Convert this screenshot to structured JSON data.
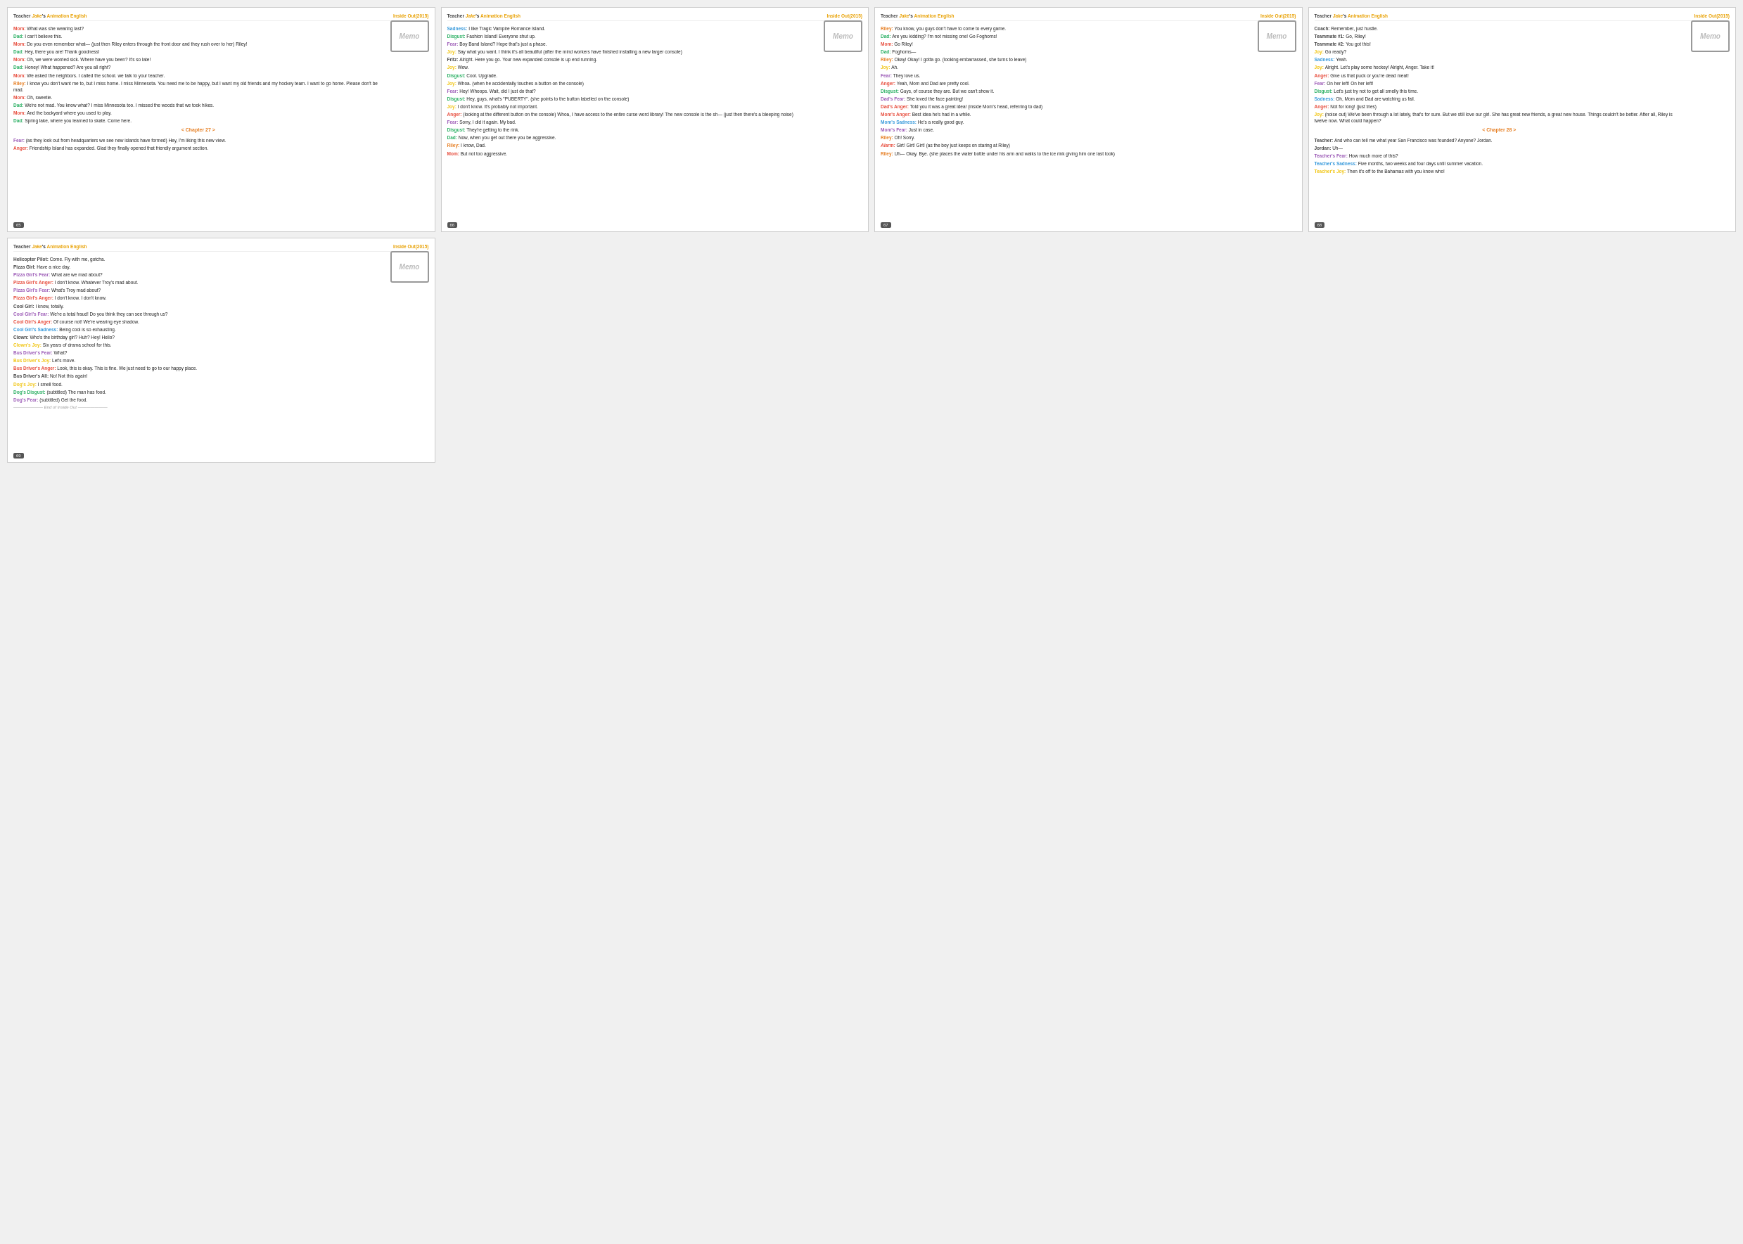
{
  "pages": [
    {
      "id": "p65",
      "number": "65",
      "lines": [
        {
          "speaker": "Mom",
          "cls": "speaker-mom",
          "text": "What was she wearing last?"
        },
        {
          "speaker": "Dad",
          "cls": "speaker-dad",
          "text": "I can't believe this."
        },
        {
          "speaker": "Mom",
          "cls": "speaker-mom",
          "text": "Do you even remember what— (just then Riley enters through the front door and they rush over to her) Riley!"
        },
        {
          "speaker": "Dad",
          "cls": "speaker-dad",
          "text": "Hey, there you are! Thank goodness!"
        },
        {
          "speaker": "Mom",
          "cls": "speaker-mom",
          "text": "Oh, we were worried sick. Where have you been? It's so late!"
        },
        {
          "speaker": "Dad",
          "cls": "speaker-dad",
          "text": "Honey! What happened? Are you all right?"
        },
        {
          "speaker": "Mom",
          "cls": "speaker-mom",
          "text": "We asked the neighbors. I called the school. we talk to your teacher."
        },
        {
          "speaker": "Riley",
          "cls": "speaker-riley",
          "text": "I know you don't want me to, but I miss home. I miss Minnesota. You need me to be happy, but I want my old friends and my hockey team. I want to go home. Please don't be mad."
        },
        {
          "speaker": "Mom",
          "cls": "speaker-mom",
          "text": "Oh, sweetie."
        },
        {
          "speaker": "Dad",
          "cls": "speaker-dad",
          "text": "We're not mad. You know what? I miss Minnesota too. I missed the woods that we took hikes."
        },
        {
          "speaker": "Mom",
          "cls": "speaker-mom",
          "text": "And the backyard where you used to play."
        },
        {
          "speaker": "Dad",
          "cls": "speaker-dad",
          "text": "Spring lake, where you learned to skate. Come here."
        },
        {
          "speaker": "chapter",
          "cls": "",
          "text": "< Chapter 27 >"
        },
        {
          "speaker": "Fear",
          "cls": "speaker-fear",
          "text": "(as they look out from headquarters we see new islands have formed) Hey, I'm liking this new view."
        },
        {
          "speaker": "Anger",
          "cls": "speaker-anger",
          "text": "Friendship Island has expanded. Glad they finally opened that friendly argument section."
        }
      ]
    },
    {
      "id": "p66",
      "number": "66",
      "lines": [
        {
          "speaker": "Sadness",
          "cls": "speaker-sadness",
          "text": "I like Tragic Vampire Romance Island."
        },
        {
          "speaker": "Disgust",
          "cls": "speaker-disgust",
          "text": "Fashion Island! Everyone shut up."
        },
        {
          "speaker": "Fear",
          "cls": "speaker-fear",
          "text": "Boy Band Island? Hope that's just a phase."
        },
        {
          "speaker": "Joy",
          "cls": "speaker-joy",
          "text": "Say what you want. I think it's all beautiful (after the mind workers have finished installing a new larger console)"
        },
        {
          "speaker": "Fritz",
          "cls": "speaker-default",
          "text": "Alright. Here you go. Your new expanded console is up end running."
        },
        {
          "speaker": "Joy",
          "cls": "speaker-joy",
          "text": "Wow."
        },
        {
          "speaker": "Disgust",
          "cls": "speaker-disgust",
          "text": "Cool. Upgrade."
        },
        {
          "speaker": "Joy",
          "cls": "speaker-joy",
          "text": "Whoa. (when he accidentally touches a button on the console)"
        },
        {
          "speaker": "Fear",
          "cls": "speaker-fear",
          "text": "Hey! Whoops. Wait, did I just do that?"
        },
        {
          "speaker": "Disgust",
          "cls": "speaker-disgust",
          "text": "Hey, guys, what's \"PUBERTY\". (she points to the button labelled on the console)"
        },
        {
          "speaker": "Joy",
          "cls": "speaker-joy",
          "text": "I don't know. It's probably not important."
        },
        {
          "speaker": "Anger",
          "cls": "speaker-anger",
          "text": "(looking at the different button on the console) Whoa, I have access to the entire curse word library! The new console is the sh— (just then there's a bleeping noise)"
        },
        {
          "speaker": "Fear",
          "cls": "speaker-fear",
          "text": "Sorry, I did it again. My bad."
        },
        {
          "speaker": "Disgust",
          "cls": "speaker-disgust",
          "text": "They're getting to the rink."
        },
        {
          "speaker": "Dad",
          "cls": "speaker-dad",
          "text": "Now, when you get out there you be aggressive."
        },
        {
          "speaker": "Riley",
          "cls": "speaker-riley",
          "text": "I know, Dad."
        },
        {
          "speaker": "Mom",
          "cls": "speaker-mom",
          "text": "But not too aggressive."
        }
      ]
    },
    {
      "id": "p67",
      "number": "67",
      "lines": [
        {
          "speaker": "Riley",
          "cls": "speaker-riley",
          "text": "You know, you guys don't have to come to every game."
        },
        {
          "speaker": "Dad",
          "cls": "speaker-dad",
          "text": "Are you kidding? I'm not missing one! Go Foghorns!"
        },
        {
          "speaker": "Mom",
          "cls": "speaker-mom",
          "text": "Go Riley!"
        },
        {
          "speaker": "Dad",
          "cls": "speaker-dad",
          "text": "Foghorns—"
        },
        {
          "speaker": "Riley",
          "cls": "speaker-riley",
          "text": "Okay! Okay! I gotta go. (looking embarrassed, she turns to leave)"
        },
        {
          "speaker": "Joy",
          "cls": "speaker-joy",
          "text": "Ah."
        },
        {
          "speaker": "Fear",
          "cls": "speaker-fear",
          "text": "They love us."
        },
        {
          "speaker": "Anger",
          "cls": "speaker-anger",
          "text": "Yeah, Mom and Dad are pretty cool."
        },
        {
          "speaker": "Disgust",
          "cls": "speaker-disgust",
          "text": "Guys, of course they are. But we can't show it."
        },
        {
          "speaker": "Dad's Fear",
          "cls": "speaker-fear",
          "text": "She loved the face painting!"
        },
        {
          "speaker": "Dad's Anger",
          "cls": "speaker-anger",
          "text": "Told you it was a great idea! (inside Mom's head, referring to dad)"
        },
        {
          "speaker": "Mom's Anger",
          "cls": "speaker-anger",
          "text": "Best idea he's had in a while."
        },
        {
          "speaker": "Mom's Sadness",
          "cls": "speaker-sadness",
          "text": "He's a really good guy."
        },
        {
          "speaker": "Mom's Fear",
          "cls": "speaker-fear",
          "text": "Just in case."
        },
        {
          "speaker": "Riley",
          "cls": "speaker-riley",
          "text": "Oh! Sorry."
        },
        {
          "speaker": "Alarm",
          "cls": "alarm",
          "text": "Girt! Girt! Girt! (as the boy just keeps on staring at Riley)"
        },
        {
          "speaker": "Riley",
          "cls": "speaker-riley",
          "text": "Uh— Okay. Bye. (she places the water bottle under his arm and walks to the ice rink giving him one last look)"
        }
      ]
    },
    {
      "id": "p68",
      "number": "68",
      "lines": [
        {
          "speaker": "Coach",
          "cls": "speaker-default",
          "text": "Remember, just hustle."
        },
        {
          "speaker": "Teammate #1",
          "cls": "speaker-default",
          "text": "Go, Riley!"
        },
        {
          "speaker": "Teammate #2",
          "cls": "speaker-default",
          "text": "You got this!"
        },
        {
          "speaker": "Joy",
          "cls": "speaker-joy",
          "text": "Go ready?"
        },
        {
          "speaker": "Sadness",
          "cls": "speaker-sadness",
          "text": "Yeah."
        },
        {
          "speaker": "Joy",
          "cls": "speaker-joy",
          "text": "Alright. Let's play some hockey! Alright, Anger. Take it!"
        },
        {
          "speaker": "Anger",
          "cls": "speaker-anger",
          "text": "Give us that puck or you're dead meat!"
        },
        {
          "speaker": "Fear",
          "cls": "speaker-fear",
          "text": "On her left! On her left!"
        },
        {
          "speaker": "Disgust",
          "cls": "speaker-disgust",
          "text": "Let's just try not to get all smelly this time."
        },
        {
          "speaker": "Sadness",
          "cls": "speaker-sadness",
          "text": "Oh, Mom and Dad are watching us fail."
        },
        {
          "speaker": "Anger",
          "cls": "speaker-anger",
          "text": "Not for long! (just tries)"
        },
        {
          "speaker": "Joy",
          "cls": "speaker-joy",
          "text": "(noise out) We've been through a lot lately, that's for sure. But we still love our girl. She has great new friends, a great new house. Things couldn't be better. After all, Riley is twelve now. What could happen?"
        },
        {
          "speaker": "chapter",
          "cls": "",
          "text": "< Chapter 28 >"
        },
        {
          "speaker": "Teacher",
          "cls": "speaker-default",
          "text": "And who can tell me what year San Francisco was founded? Anyone? Jordan."
        },
        {
          "speaker": "Jordan",
          "cls": "speaker-default",
          "text": "Uh—"
        },
        {
          "speaker": "Teacher's Fear",
          "cls": "speaker-fear",
          "text": "How much more of this?"
        },
        {
          "speaker": "Teacher's Sadness",
          "cls": "speaker-sadness",
          "text": "Five months, two weeks and four days until summer vacation."
        },
        {
          "speaker": "Teacher's Joy",
          "cls": "speaker-joy",
          "text": "Then it's off to the Bahamas with you know who!"
        }
      ]
    }
  ],
  "page_bottom": [
    {
      "id": "p69",
      "number": "69",
      "lines": [
        {
          "speaker": "Helicopter Pilot",
          "cls": "speaker-default",
          "text": "Come. Fly with me, gotcha."
        },
        {
          "speaker": "Pizza Girl",
          "cls": "speaker-default",
          "text": "Have a nice day."
        },
        {
          "speaker": "Pizza Girl's Fear",
          "cls": "speaker-fear",
          "text": "What are we mad about?"
        },
        {
          "speaker": "Pizza Girl's Anger",
          "cls": "speaker-anger",
          "text": "I don't know. Whatever Troy's mad about."
        },
        {
          "speaker": "Pizza Girl's Fear",
          "cls": "speaker-fear",
          "text": "What's Troy mad about?"
        },
        {
          "speaker": "Pizza Girl's Anger",
          "cls": "speaker-anger",
          "text": "I don't know. I don't know."
        },
        {
          "speaker": "Cool Girl",
          "cls": "speaker-default",
          "text": "I know, totally."
        },
        {
          "speaker": "Cool Girl's Fear",
          "cls": "speaker-fear",
          "text": "We're a total fraud! Do you think they can see through us?"
        },
        {
          "speaker": "Cool Girl's Anger",
          "cls": "speaker-anger",
          "text": "Of course not! We're wearing eye shadow."
        },
        {
          "speaker": "Cool Girl's Sadness",
          "cls": "speaker-sadness",
          "text": "Being cool is so exhausting."
        },
        {
          "speaker": "Clown",
          "cls": "speaker-default",
          "text": "Who's the birthday girl? Huh? Hey! Hello?"
        },
        {
          "speaker": "Clown's Joy",
          "cls": "speaker-joy",
          "text": "Six years of drama school for this."
        },
        {
          "speaker": "Bus Driver's Fear",
          "cls": "speaker-fear",
          "text": "What?"
        },
        {
          "speaker": "Bus Driver's Joy",
          "cls": "speaker-joy",
          "text": "Let's move."
        },
        {
          "speaker": "Bus Driver's Anger",
          "cls": "speaker-anger",
          "text": "Look, this is okay. This is fine. We just need to go to our happy place."
        },
        {
          "speaker": "Bus Driver's All",
          "cls": "speaker-default",
          "text": "No! Not this again!"
        },
        {
          "speaker": "Dog's Joy",
          "cls": "speaker-joy",
          "text": "I smell food."
        },
        {
          "speaker": "Dog's Disgust",
          "cls": "speaker-disgust",
          "text": "(subtitled) The man has food."
        },
        {
          "speaker": "Dog's Fear",
          "cls": "speaker-fear",
          "text": "(subtitled) Get the food."
        },
        {
          "speaker": "end",
          "cls": "",
          "text": "——————— End of Inside Out ———————"
        }
      ]
    }
  ],
  "header": {
    "left_static": "Teacher Jake's Animation English",
    "right_static": "Inside Out(2015)"
  }
}
